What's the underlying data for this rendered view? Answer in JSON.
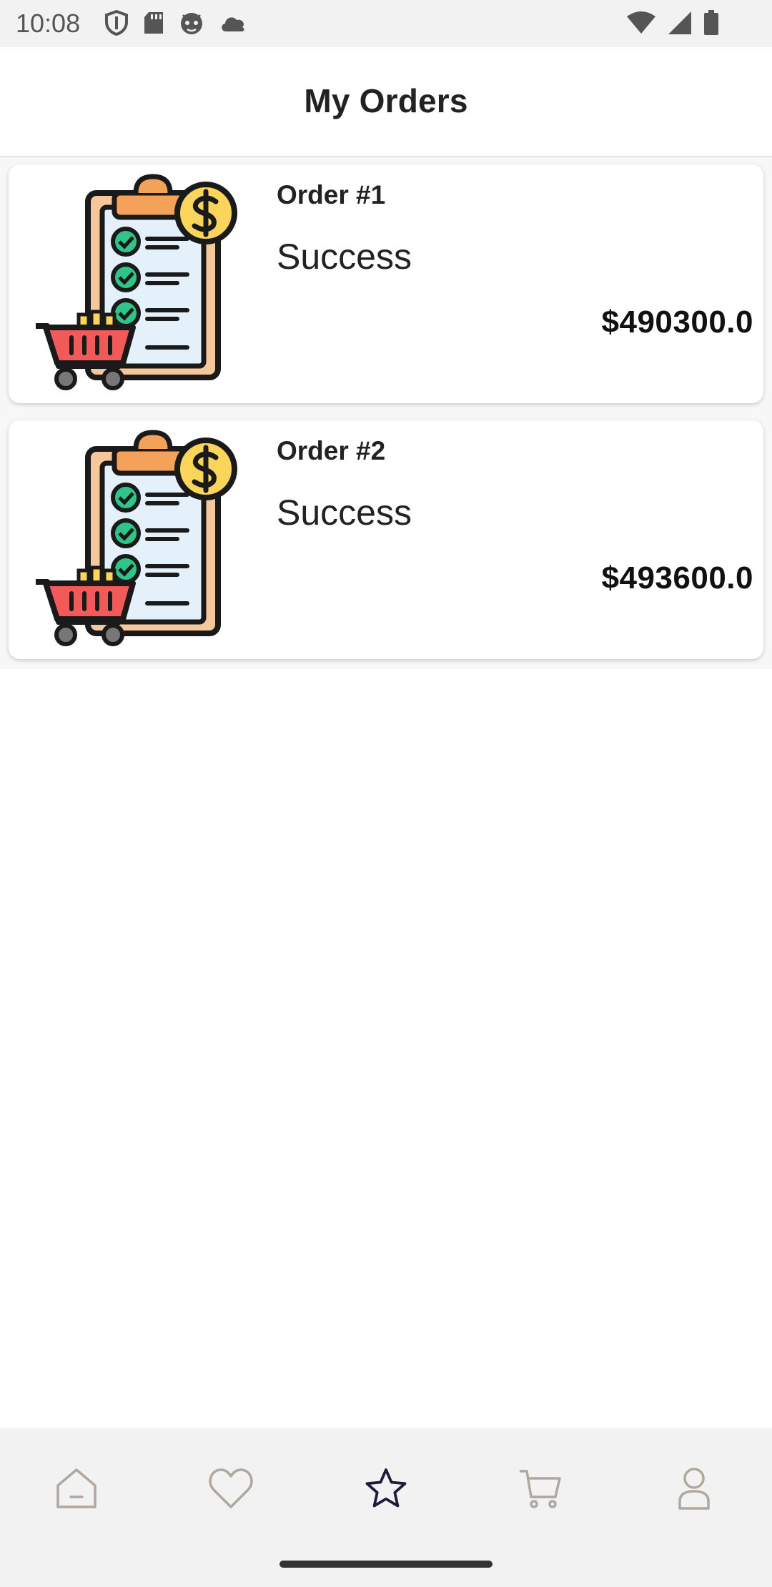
{
  "status_bar": {
    "time": "10:08",
    "left_icons": [
      "shield-icon",
      "sd-card-icon",
      "android-icon",
      "cloud-icon"
    ],
    "right_icons": [
      "wifi-icon",
      "signal-icon",
      "battery-icon"
    ]
  },
  "header": {
    "title": "My Orders"
  },
  "orders": [
    {
      "title": "Order #1",
      "status": "Success",
      "total": "$490300.0"
    },
    {
      "title": "Order #2",
      "status": "Success",
      "total": "$493600.0"
    }
  ],
  "bottom_nav": {
    "items": [
      {
        "icon": "home-icon",
        "active": false
      },
      {
        "icon": "heart-icon",
        "active": false
      },
      {
        "icon": "star-icon",
        "active": true
      },
      {
        "icon": "cart-icon",
        "active": false
      },
      {
        "icon": "profile-icon",
        "active": false
      }
    ],
    "colors": {
      "active": "#1c1c3a",
      "inactive": "#b0a89e"
    }
  }
}
